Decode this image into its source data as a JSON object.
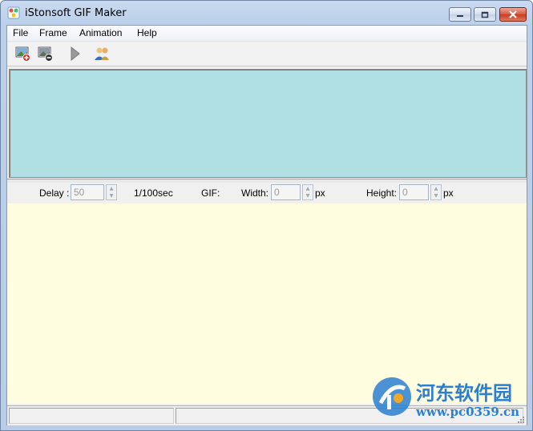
{
  "window": {
    "title": "iStonsoft GIF Maker",
    "icon": "app-gif-icon"
  },
  "caption_buttons": [
    "minimize-icon",
    "maximize-icon",
    "close-icon"
  ],
  "menu": {
    "items": [
      {
        "label": "File"
      },
      {
        "label": "Frame"
      },
      {
        "label": "Animation"
      },
      {
        "label": "Help"
      }
    ]
  },
  "toolbar": {
    "tools": [
      {
        "name": "add-image",
        "icon": "add-image-icon"
      },
      {
        "name": "remove-image",
        "icon": "remove-image-icon"
      },
      {
        "name": "play",
        "icon": "play-icon"
      },
      {
        "name": "users",
        "icon": "users-icon"
      }
    ]
  },
  "properties": {
    "delay_label": "Delay :",
    "delay_value": "50",
    "delay_unit": "1/100sec",
    "gif_label": "GIF:",
    "width_label": "Width:",
    "width_value": "0",
    "width_unit": "px",
    "height_label": "Height:",
    "height_value": "0",
    "height_unit": "px"
  },
  "colors": {
    "preview_bg": "#b0e0e4",
    "frames_bg": "#fffde0",
    "watermark": "#2a7fd0"
  },
  "watermark": {
    "text": "河东软件园",
    "url": "www.pc0359.cn"
  }
}
